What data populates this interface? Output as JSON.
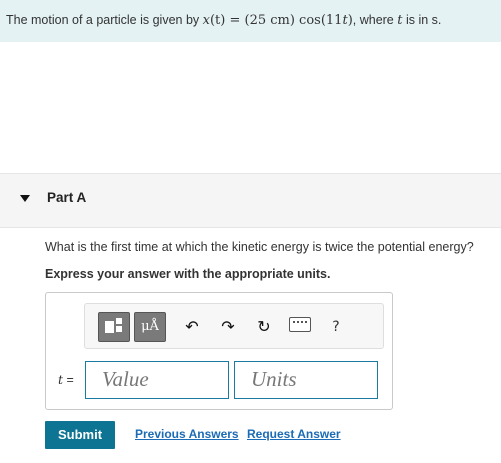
{
  "intro": {
    "prefix": "The motion of a particle is given by ",
    "x": "x",
    "t_arg": "(t)",
    "equals": " = (25 cm) cos(11",
    "t_inner": "t",
    "close": ")",
    "suffix": ", where ",
    "t_var": "t",
    "tail": " is in s."
  },
  "part": {
    "title": "Part A"
  },
  "question": "What is the first time at which the kinetic energy is twice the potential energy?",
  "instruction": "Express your answer with the appropriate units.",
  "toolbar": {
    "templates_icon": "templates-icon",
    "units_label": "μÅ",
    "undo": "↶",
    "redo": "↷",
    "reset": "↻",
    "help": "?"
  },
  "answer": {
    "variable": "t",
    "equals": " =",
    "value_placeholder": "Value",
    "units_placeholder": "Units"
  },
  "actions": {
    "submit": "Submit",
    "previous": "Previous Answers",
    "request": "Request Answer"
  },
  "colors": {
    "accent": "#0d7493",
    "link": "#1b6bb5",
    "intro_bg": "#e4f2f4"
  }
}
